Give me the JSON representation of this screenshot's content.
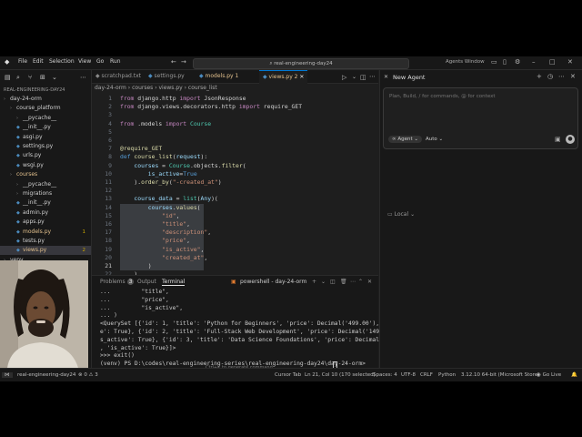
{
  "window": {
    "menu": [
      "File",
      "Edit",
      "Selection",
      "View",
      "Go",
      "Run"
    ],
    "search_text": "real-engineering-day24",
    "title_right": "Agents Window"
  },
  "explorer": {
    "root": "REAL-ENGINEERING-DAY24",
    "items": [
      {
        "label": "day-24-orm",
        "kind": "folder",
        "indent": 1,
        "color": "#cfcfcf"
      },
      {
        "label": "course_platform",
        "kind": "folder",
        "indent": 2,
        "color": "#cfcfcf"
      },
      {
        "label": "__pycache__",
        "kind": "folder",
        "indent": 3,
        "color": "#cfcfcf"
      },
      {
        "label": "__init__.py",
        "kind": "file",
        "indent": 3,
        "color": "#cfcfcf"
      },
      {
        "label": "asgi.py",
        "kind": "file",
        "indent": 3,
        "color": "#cfcfcf"
      },
      {
        "label": "settings.py",
        "kind": "file",
        "indent": 3,
        "color": "#cfcfcf"
      },
      {
        "label": "urls.py",
        "kind": "file",
        "indent": 3,
        "color": "#cfcfcf"
      },
      {
        "label": "wsgi.py",
        "kind": "file",
        "indent": 3,
        "color": "#cfcfcf"
      },
      {
        "label": "courses",
        "kind": "folder",
        "indent": 2,
        "color": "#e2c08d"
      },
      {
        "label": "__pycache__",
        "kind": "folder",
        "indent": 3,
        "color": "#cfcfcf"
      },
      {
        "label": "migrations",
        "kind": "folder",
        "indent": 3,
        "color": "#cfcfcf"
      },
      {
        "label": "__init__.py",
        "kind": "file",
        "indent": 3,
        "color": "#cfcfcf"
      },
      {
        "label": "admin.py",
        "kind": "file",
        "indent": 3,
        "color": "#cfcfcf"
      },
      {
        "label": "apps.py",
        "kind": "file",
        "indent": 3,
        "color": "#cfcfcf"
      },
      {
        "label": "models.py",
        "kind": "file",
        "indent": 3,
        "color": "#e2c08d",
        "count": "1"
      },
      {
        "label": "tests.py",
        "kind": "file",
        "indent": 3,
        "color": "#cfcfcf"
      },
      {
        "label": "views.py",
        "kind": "file",
        "indent": 3,
        "color": "#e2c08d",
        "count": "2",
        "selected": true
      },
      {
        "label": "venv",
        "kind": "folder",
        "indent": 1,
        "color": "#cfcfcf"
      }
    ]
  },
  "tabs": [
    {
      "label": "scratchpad.txt",
      "active": false
    },
    {
      "label": "settings.py",
      "active": false
    },
    {
      "label": "models.py 1",
      "active": false
    },
    {
      "label": "views.py 2",
      "active": true
    }
  ],
  "breadcrumb": "day-24-orm  ›  courses  ›  views.py  ›  course_list",
  "code": {
    "lines": [
      {
        "n": "1",
        "segs": [
          [
            "kw",
            "from "
          ],
          [
            "",
            "django.http "
          ],
          [
            "kw",
            "import "
          ],
          [
            "",
            "JsonResponse"
          ]
        ]
      },
      {
        "n": "2",
        "segs": [
          [
            "kw",
            "from "
          ],
          [
            "",
            "django.views.decorators.http "
          ],
          [
            "kw",
            "import "
          ],
          [
            "",
            "require_GET"
          ]
        ]
      },
      {
        "n": "3",
        "segs": []
      },
      {
        "n": "4",
        "segs": [
          [
            "kw",
            "from "
          ],
          [
            "",
            ".models "
          ],
          [
            "kw",
            "import "
          ],
          [
            "cls",
            "Course"
          ]
        ]
      },
      {
        "n": "5",
        "segs": []
      },
      {
        "n": "6",
        "segs": []
      },
      {
        "n": "7",
        "segs": [
          [
            "dec",
            "@require_GET"
          ]
        ]
      },
      {
        "n": "8",
        "segs": [
          [
            "kw2",
            "def "
          ],
          [
            "fn",
            "course_list"
          ],
          [
            "",
            "("
          ],
          [
            "var",
            "request"
          ],
          [
            "",
            "):"
          ]
        ]
      },
      {
        "n": "9",
        "segs": [
          [
            "",
            "    "
          ],
          [
            "var",
            "courses"
          ],
          [
            "",
            " = "
          ],
          [
            "cls",
            "Course"
          ],
          [
            "",
            ".objects."
          ],
          [
            "fn",
            "filter"
          ],
          [
            "",
            "("
          ]
        ]
      },
      {
        "n": "10",
        "segs": [
          [
            "",
            "        "
          ],
          [
            "var",
            "is_active"
          ],
          [
            "",
            "="
          ],
          [
            "kw2",
            "True"
          ]
        ]
      },
      {
        "n": "11",
        "segs": [
          [
            "",
            "    )."
          ],
          [
            "fn",
            "order_by"
          ],
          [
            "",
            "("
          ],
          [
            "str",
            "\"-created_at\""
          ],
          [
            "",
            ")"
          ]
        ]
      },
      {
        "n": "12",
        "segs": []
      },
      {
        "n": "13",
        "segs": [
          [
            "",
            "    "
          ],
          [
            "var",
            "course_data"
          ],
          [
            "",
            " = "
          ],
          [
            "cls",
            "list"
          ],
          [
            "",
            "("
          ],
          [
            "var",
            "Any"
          ],
          [
            "",
            ")("
          ]
        ]
      },
      {
        "n": "14",
        "segs": [
          [
            "",
            "        "
          ],
          [
            "var",
            "courses"
          ],
          [
            "",
            "."
          ],
          [
            "fn",
            "values"
          ],
          [
            "",
            "("
          ]
        ],
        "hl": true
      },
      {
        "n": "15",
        "segs": [
          [
            "",
            "            "
          ],
          [
            "str",
            "\"id\""
          ],
          [
            "",
            ","
          ]
        ],
        "hl": true
      },
      {
        "n": "16",
        "segs": [
          [
            "",
            "            "
          ],
          [
            "str",
            "\"title\""
          ],
          [
            "",
            ","
          ]
        ],
        "hl": true
      },
      {
        "n": "17",
        "segs": [
          [
            "",
            "            "
          ],
          [
            "str",
            "\"description\""
          ],
          [
            "",
            ","
          ]
        ],
        "hl": true
      },
      {
        "n": "18",
        "segs": [
          [
            "",
            "            "
          ],
          [
            "str",
            "\"price\""
          ],
          [
            "",
            ","
          ]
        ],
        "hl": true
      },
      {
        "n": "19",
        "segs": [
          [
            "",
            "            "
          ],
          [
            "str",
            "\"is_active\""
          ],
          [
            "",
            ","
          ]
        ],
        "hl": true
      },
      {
        "n": "20",
        "segs": [
          [
            "",
            "            "
          ],
          [
            "str",
            "\"created_at\""
          ],
          [
            "",
            ","
          ]
        ],
        "hl": true
      },
      {
        "n": "21",
        "segs": [
          [
            "",
            "        )"
          ]
        ],
        "hl": true
      },
      {
        "n": "22",
        "segs": [
          [
            "",
            "    )"
          ]
        ]
      }
    ]
  },
  "panel": {
    "tabs": [
      "Problems",
      "Output",
      "Terminal"
    ],
    "problems_count": "3",
    "active_tab": "Terminal",
    "terminal_name": "powershell - day-24-orm"
  },
  "terminal": {
    "lines": [
      "...         \"title\",",
      "...         \"price\",",
      "...         \"is_active\",",
      "... )",
      "<QuerySet [{'id': 1, 'title': 'Python for Beginners', 'price': Decimal('499.00'), 'is_activ",
      "e': True}, {'id': 2, 'title': 'Full-Stack Web Development', 'price': Decimal('1499.00'), 'i",
      "s_active': True}, {'id': 3, 'title': 'Data Science Foundations', 'price': Decimal('999.00')",
      ", 'is_active': True}]>",
      ">>> exit()",
      "(venv) PS D:\\codes\\real-engineering-series\\real-engineering-day24\\day-24-orm> "
    ]
  },
  "agent": {
    "title": "New Agent",
    "placeholder": "Plan, Build, / for commands, @ for context",
    "mode": "Agent",
    "model": "Auto",
    "location": "Local"
  },
  "status": {
    "branch": "real-engineering-day24",
    "errors": "0",
    "warnings": "3",
    "hint": "Ctrl+K to generate command",
    "right": [
      "Cursor Tab",
      "Ln 21, Col 10 (170 selected)",
      "Spaces: 4",
      "UTF-8",
      "CRLF",
      "Python",
      "3.12.10 64-bit (Microsoft Store)",
      "Go Live"
    ]
  },
  "colors": {
    "accent": "#0078d4",
    "modified": "#e2c08d",
    "warning": "#cca700"
  }
}
